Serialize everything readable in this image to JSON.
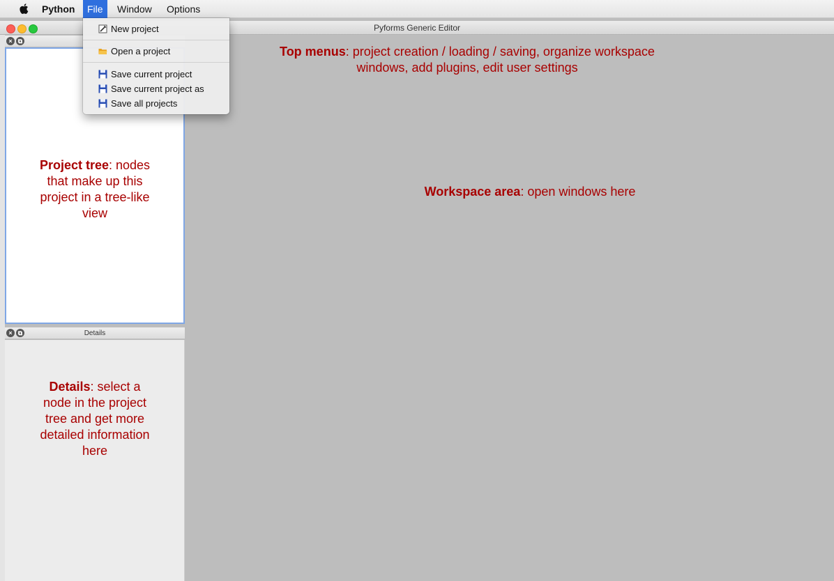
{
  "menubar": {
    "app_name": "Python",
    "menus": [
      "File",
      "Window",
      "Options"
    ],
    "active_menu": "File"
  },
  "window": {
    "title": "Pyforms Generic Editor"
  },
  "file_menu": {
    "items": [
      {
        "label": "New project",
        "icon": "new-project-icon"
      },
      {
        "label": "Open a project",
        "icon": "folder-icon"
      },
      {
        "label": "Save current project",
        "icon": "floppy-disk-icon"
      },
      {
        "label": "Save current project as",
        "icon": "floppy-disk-icon"
      },
      {
        "label": "Save all projects",
        "icon": "floppy-disk-icon"
      }
    ]
  },
  "details_dock": {
    "title": "Details"
  },
  "annotations": {
    "top_menus": {
      "bold": "Top menus",
      "line1_rest": ": project creation / loading / saving, organize workspace",
      "line2": "windows, add plugins, edit user settings"
    },
    "project_tree": {
      "bold": "Project tree",
      "line1_rest": ": nodes",
      "line2": "that make up this",
      "line3": "project in a tree-like",
      "line4": "view"
    },
    "workspace": {
      "bold": "Workspace area",
      "rest": ": open windows here"
    },
    "details": {
      "bold": "Details",
      "line1_rest": ": select a",
      "line2": "node in the project",
      "line3": "tree and get more",
      "line4": "detailed information",
      "line5": "here"
    }
  },
  "colors": {
    "annotation_text": "#a80000",
    "menu_highlight": "#2f6fde",
    "workspace_bg": "#bdbdbd",
    "tree_border": "#7fa7e6"
  }
}
